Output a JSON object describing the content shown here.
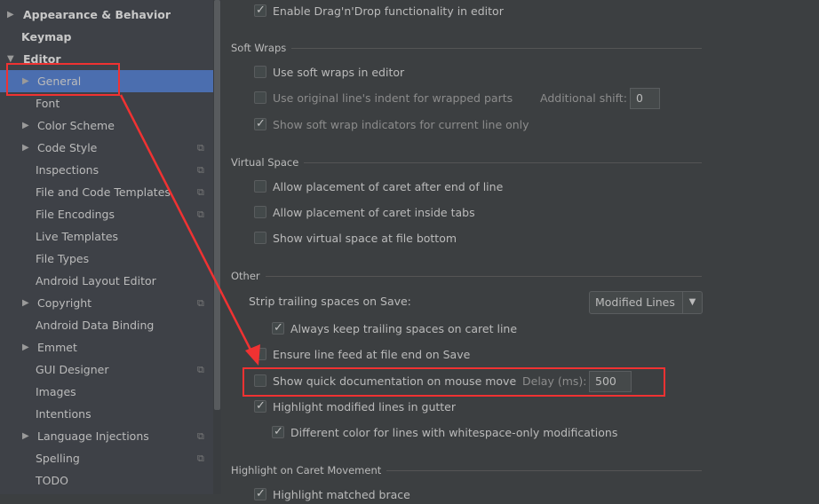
{
  "sidebar": {
    "items": [
      {
        "label": "Appearance & Behavior",
        "expander": "collapsed",
        "level": 0
      },
      {
        "label": "Keymap",
        "level": 0
      },
      {
        "label": "Editor",
        "expander": "expanded",
        "level": 0
      },
      {
        "label": "General",
        "expander": "collapsed",
        "level": 1,
        "selected": true
      },
      {
        "label": "Font",
        "level": 1
      },
      {
        "label": "Color Scheme",
        "expander": "collapsed",
        "level": 1
      },
      {
        "label": "Code Style",
        "expander": "collapsed",
        "level": 1,
        "copy_icon": true
      },
      {
        "label": "Inspections",
        "level": 1,
        "copy_icon": true
      },
      {
        "label": "File and Code Templates",
        "level": 1,
        "copy_icon": true
      },
      {
        "label": "File Encodings",
        "level": 1,
        "copy_icon": true
      },
      {
        "label": "Live Templates",
        "level": 1
      },
      {
        "label": "File Types",
        "level": 1
      },
      {
        "label": "Android Layout Editor",
        "level": 1
      },
      {
        "label": "Copyright",
        "expander": "collapsed",
        "level": 1,
        "copy_icon": true
      },
      {
        "label": "Android Data Binding",
        "level": 1
      },
      {
        "label": "Emmet",
        "expander": "collapsed",
        "level": 1
      },
      {
        "label": "GUI Designer",
        "level": 1,
        "copy_icon": true
      },
      {
        "label": "Images",
        "level": 1
      },
      {
        "label": "Intentions",
        "level": 1
      },
      {
        "label": "Language Injections",
        "expander": "collapsed",
        "level": 1,
        "copy_icon": true
      },
      {
        "label": "Spelling",
        "level": 1,
        "copy_icon": true
      },
      {
        "label": "TODO",
        "level": 1
      }
    ]
  },
  "main": {
    "dragdrop": {
      "label": "Enable Drag'n'Drop functionality in editor",
      "checked": true
    },
    "soft_wraps": {
      "title": "Soft Wraps",
      "use_soft_wraps": "Use soft wraps in editor",
      "original_indent": "Use original line's indent for wrapped parts",
      "additional_shift_label": "Additional shift:",
      "additional_shift_value": "0",
      "show_indicators": "Show soft wrap indicators for current line only"
    },
    "virtual_space": {
      "title": "Virtual Space",
      "after_eol": "Allow placement of caret after end of line",
      "inside_tabs": "Allow placement of caret inside tabs",
      "file_bottom": "Show virtual space at file bottom"
    },
    "other": {
      "title": "Other",
      "strip_label": "Strip trailing spaces on Save:",
      "strip_value": "Modified Lines",
      "keep_trailing": "Always keep trailing spaces on caret line",
      "line_feed": "Ensure line feed at file end on Save",
      "quick_doc": "Show quick documentation on mouse move",
      "delay_label": "Delay (ms):",
      "delay_value": "500",
      "highlight_modified": "Highlight modified lines in gutter",
      "whitespace_color": "Different color for lines with whitespace-only modifications"
    },
    "caret": {
      "title": "Highlight on Caret Movement",
      "first_item": "Highlight matched brace"
    }
  },
  "annotation_color": "#f03232"
}
